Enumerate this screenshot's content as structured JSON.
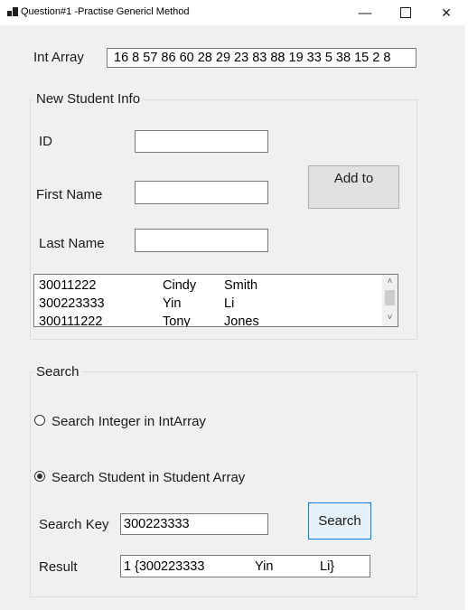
{
  "window": {
    "title": "Question#1 -Practise Genericl Method",
    "minimize_glyph": "—",
    "maximize_glyph": "☐",
    "close_glyph": "✕"
  },
  "int_array": {
    "label": "Int Array",
    "value": "16 8 57 86 60 28 29 23 83 88 19 33 5 38 15 2 8"
  },
  "new_student": {
    "caption": "New Student Info",
    "id_label": "ID",
    "id_value": "",
    "first_name_label": "First Name",
    "first_name_value": "",
    "last_name_label": "Last Name",
    "last_name_value": "",
    "add_button": "Add to"
  },
  "student_list": {
    "rows": [
      {
        "id": "30011222",
        "first": "Cindy",
        "last": "Smith"
      },
      {
        "id": "300223333",
        "first": "Yin",
        "last": "Li"
      },
      {
        "id": "300111222",
        "first": "Tony",
        "last": "Jones"
      }
    ],
    "scroll_up_glyph": "˄",
    "scroll_down_glyph": "˅"
  },
  "search": {
    "caption": "Search",
    "option_integer": "Search Integer in IntArray",
    "option_student": "Search Student in Student Array",
    "selected_option": "student",
    "key_label": "Search Key",
    "key_value": "300223333",
    "search_button": "Search",
    "result_label": "Result",
    "result": {
      "index": "1",
      "id": "{300223333",
      "first": "Yin",
      "last": "Li}"
    }
  }
}
